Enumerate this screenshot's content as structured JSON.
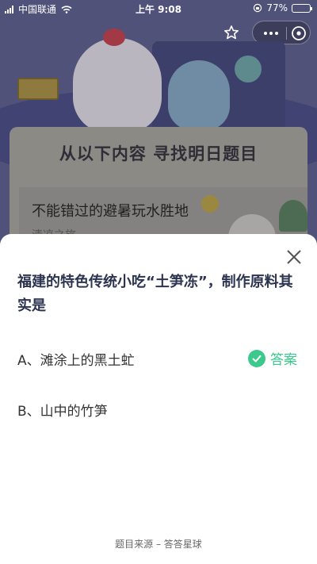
{
  "status_bar": {
    "carrier": "中国联通",
    "time": "上午 9:08",
    "battery": "77%",
    "battery_level": 0.77
  },
  "background": {
    "banner": "从以下内容  寻找明日题目",
    "article_title": "不能错过的避暑玩水胜地",
    "article_subtitle": "清凉之旅"
  },
  "quiz": {
    "question": "福建的特色传统小吃“土笋冻”，制作原料其实是",
    "options": [
      {
        "label": "A、滩涂上的黑土虻",
        "is_answer": true
      },
      {
        "label": "B、山中的竹笋",
        "is_answer": false
      }
    ],
    "answer_label": "答案",
    "source": "题目来源 – 答答星球"
  },
  "colors": {
    "accent_green": "#3cc98c",
    "question_text": "#2c3450"
  },
  "icons": {
    "star": "star-icon",
    "more": "more-icon",
    "close_capsule": "close-circle-icon",
    "sheet_close": "close-icon",
    "check": "check-circle-icon"
  }
}
